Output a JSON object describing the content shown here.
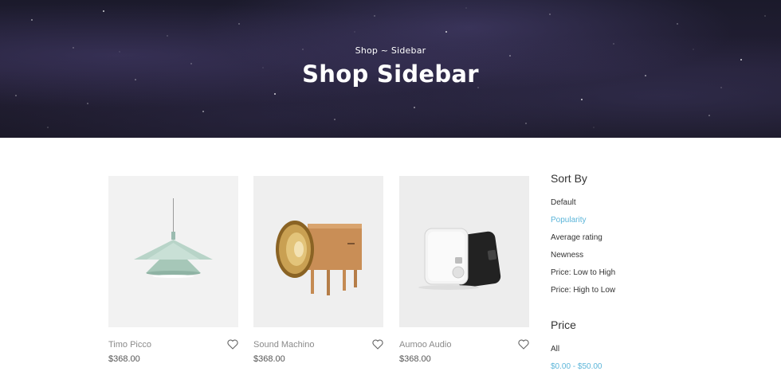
{
  "hero": {
    "breadcrumb": "Shop ~ Sidebar",
    "title": "Shop Sidebar"
  },
  "products": [
    {
      "name": "Timo Picco",
      "price": "$368.00",
      "icon": "pendant-lamp"
    },
    {
      "name": "Sound Machino",
      "price": "$368.00",
      "icon": "horn-speaker-cabinet"
    },
    {
      "name": "Aumoo Audio",
      "price": "$368.00",
      "icon": "audio-device"
    }
  ],
  "sidebar": {
    "sort_heading": "Sort By",
    "sort_options": [
      "Default",
      "Popularity",
      "Average rating",
      "Newness",
      "Price: Low to High",
      "Price: High to Low"
    ],
    "sort_active": "Popularity",
    "price_heading": "Price",
    "price_options": [
      "All",
      "$0.00 - $50.00"
    ],
    "price_active": "$0.00 - $50.00"
  },
  "colors": {
    "accent": "#5bb5d9",
    "hero_bg": "#1f1c2e"
  }
}
